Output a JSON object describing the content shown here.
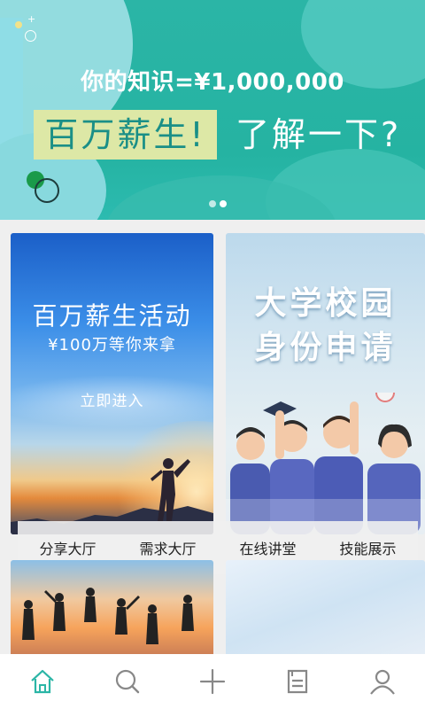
{
  "banner": {
    "headline": "你的知识=¥1,000,000",
    "highlight": "百万薪生!",
    "subtext": "了解一下?",
    "dots": 2,
    "active_dot": 1,
    "colors": {
      "background": "#25b3a2",
      "highlight_box": "#dde8a6",
      "highlight_text": "#1a8f87"
    }
  },
  "cards": {
    "left": {
      "title": "百万薪生活动",
      "subtitle": "¥100万等你来拿",
      "button": "立即进入"
    },
    "right": {
      "title_line1": "大学校园",
      "title_line2": "身份申请"
    }
  },
  "categories": [
    "分享大厅",
    "需求大厅",
    "在线讲堂",
    "技能展示"
  ],
  "bottom_nav": {
    "items": [
      {
        "icon": "home-icon",
        "active": true
      },
      {
        "icon": "search-icon",
        "active": false
      },
      {
        "icon": "plus-icon",
        "active": false
      },
      {
        "icon": "list-icon",
        "active": false
      },
      {
        "icon": "user-icon",
        "active": false
      }
    ],
    "colors": {
      "active": "#2bb5a6",
      "inactive": "#888888"
    }
  }
}
